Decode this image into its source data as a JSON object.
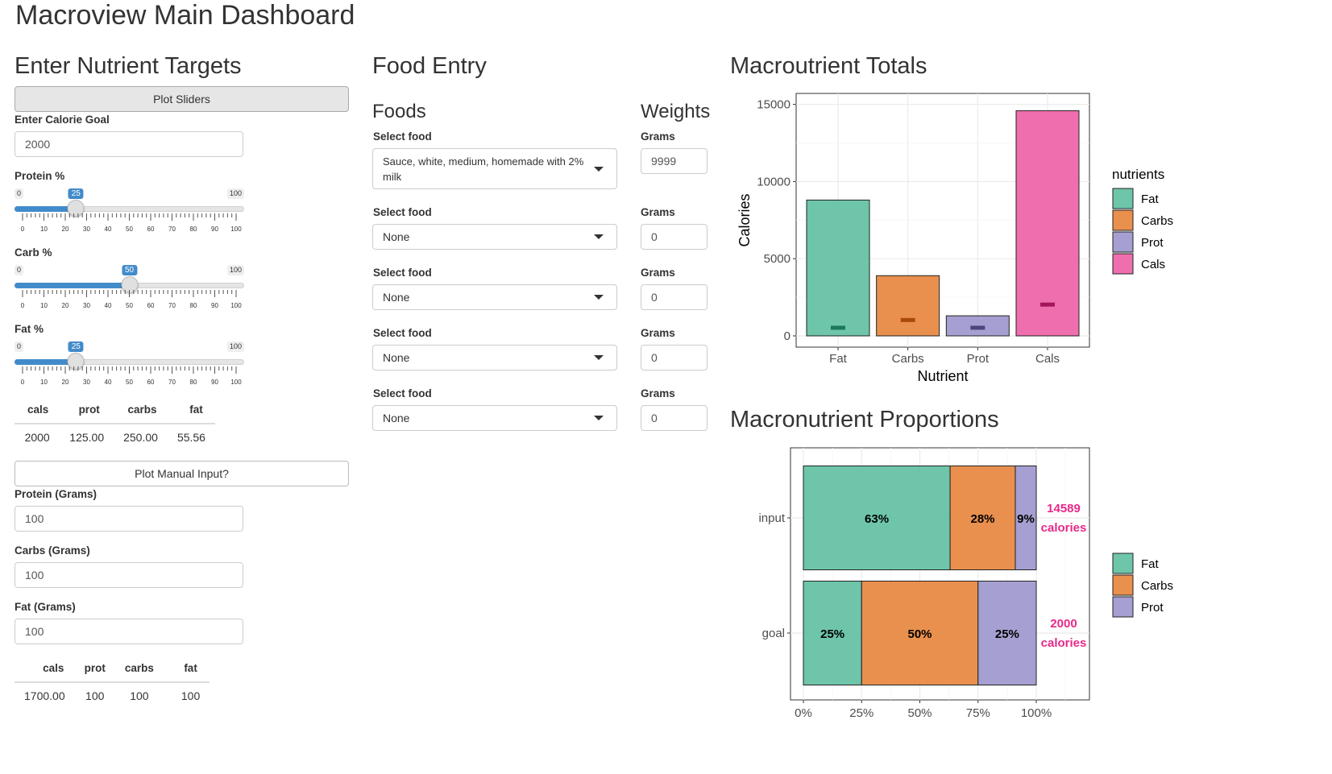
{
  "page": {
    "title": "Macroview Main Dashboard"
  },
  "targets": {
    "heading": "Enter Nutrient Targets",
    "plot_sliders_button": "Plot Sliders",
    "calorie_label": "Enter Calorie Goal",
    "calorie_value": "2000",
    "sliders": [
      {
        "label": "Protein %",
        "min": "0",
        "max": "100",
        "value": 25,
        "value_text": "25"
      },
      {
        "label": "Carb %",
        "min": "0",
        "max": "100",
        "value": 50,
        "value_text": "50"
      },
      {
        "label": "Fat %",
        "min": "0",
        "max": "100",
        "value": 25,
        "value_text": "25"
      }
    ],
    "slider_tick_labels": [
      "0",
      "10",
      "20",
      "30",
      "40",
      "50",
      "60",
      "70",
      "80",
      "90",
      "100"
    ],
    "slider_table": {
      "headers": [
        "cals",
        "prot",
        "carbs",
        "fat"
      ],
      "row": [
        "2000",
        "125.00",
        "250.00",
        "55.56"
      ]
    },
    "manual_button": "Plot Manual Input?",
    "manual_fields": [
      {
        "label": "Protein (Grams)",
        "value": "100"
      },
      {
        "label": "Carbs (Grams)",
        "value": "100"
      },
      {
        "label": "Fat (Grams)",
        "value": "100"
      }
    ],
    "manual_table": {
      "headers": [
        "cals",
        "prot",
        "carbs",
        "fat"
      ],
      "row": [
        "1700.00",
        "100",
        "100",
        "100"
      ]
    }
  },
  "food_entry": {
    "heading": "Food Entry",
    "foods_heading": "Foods",
    "weights_heading": "Weights",
    "rows": [
      {
        "select_label": "Select food",
        "selected": "Sauce, white, medium, homemade with 2% milk",
        "grams_label": "Grams",
        "grams": "9999"
      },
      {
        "select_label": "Select food",
        "selected": "None",
        "grams_label": "Grams",
        "grams": "0"
      },
      {
        "select_label": "Select food",
        "selected": "None",
        "grams_label": "Grams",
        "grams": "0"
      },
      {
        "select_label": "Select food",
        "selected": "None",
        "grams_label": "Grams",
        "grams": "0"
      },
      {
        "select_label": "Select food",
        "selected": "None",
        "grams_label": "Grams",
        "grams": "0"
      }
    ]
  },
  "totals": {
    "heading": "Macroutrient Totals",
    "legend_title": "nutrients",
    "legend": [
      "Fat",
      "Carbs",
      "Prot",
      "Cals"
    ]
  },
  "proportions": {
    "heading": "Macronutrient Proportions",
    "legend": [
      "Fat",
      "Carbs",
      "Prot"
    ]
  },
  "colors": {
    "fat": "#66c2a5",
    "carbs": "#e88a45",
    "prot": "#a09bcf",
    "cals": "#ee66aa",
    "accent": "#428bca",
    "calorie_label": "#e7298a"
  },
  "chart_data": [
    {
      "type": "bar",
      "title": "Macroutrient Totals",
      "xlabel": "Nutrient",
      "ylabel": "Calories",
      "categories": [
        "Fat",
        "Carbs",
        "Prot",
        "Cals"
      ],
      "values": [
        8800,
        3900,
        1300,
        14589
      ],
      "goal_markers": [
        500,
        1000,
        500,
        2000
      ],
      "ylim": [
        0,
        15500
      ],
      "yticks": [
        0,
        5000,
        10000,
        15000
      ],
      "ytick_labels": [
        "0",
        "5000",
        "10000",
        "15000"
      ],
      "grid": true,
      "legend_title": "nutrients",
      "legend_position": "right"
    },
    {
      "type": "bar",
      "stacked": true,
      "orientation": "horizontal",
      "title": "Macronutrient Proportions",
      "categories": [
        "input",
        "goal"
      ],
      "series": [
        {
          "name": "Fat",
          "values": [
            63,
            25
          ],
          "labels": [
            "63%",
            "25%"
          ]
        },
        {
          "name": "Carbs",
          "values": [
            28,
            50
          ],
          "labels": [
            "28%",
            "50%"
          ]
        },
        {
          "name": "Prot",
          "values": [
            9,
            25
          ],
          "labels": [
            "9%",
            "25%"
          ]
        }
      ],
      "calorie_labels": [
        [
          "14589",
          "calories"
        ],
        [
          "2000",
          "calories"
        ]
      ],
      "xlim": [
        0,
        120
      ],
      "xticks": [
        0,
        25,
        50,
        75,
        100
      ],
      "xtick_labels": [
        "0%",
        "25%",
        "50%",
        "75%",
        "100%"
      ],
      "grid": true,
      "legend_position": "right"
    }
  ]
}
